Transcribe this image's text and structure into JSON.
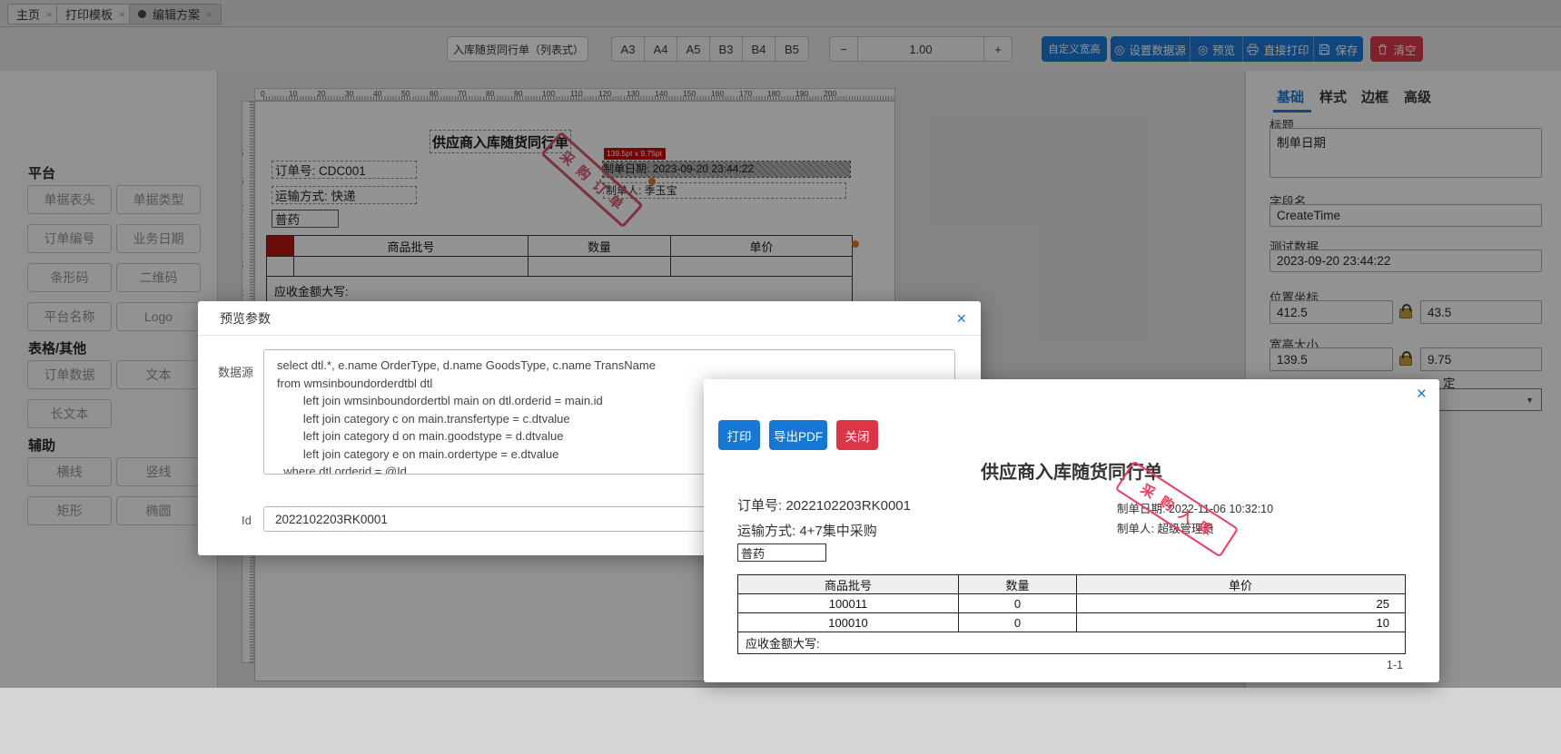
{
  "tabs": {
    "items": [
      {
        "label": "主页"
      },
      {
        "label": "打印模板"
      },
      {
        "label": "编辑方案"
      }
    ],
    "close_glyph": "×"
  },
  "toolbar": {
    "template_name": "入库随货同行单（列表式）【带",
    "paper_sizes": [
      "A3",
      "A4",
      "A5",
      "B3",
      "B4",
      "B5"
    ],
    "zoom_out": "−",
    "zoom_value": "1.00",
    "zoom_in": "+",
    "custom_size": "自定义宽高",
    "set_datasource": "设置数据源",
    "preview": "预览",
    "direct_print": "直接打印",
    "save": "保存",
    "clear": "清空",
    "ring_icon": "◎"
  },
  "sidebar": {
    "sections": [
      {
        "title": "平台",
        "buttons": [
          "单据表头",
          "单据类型",
          "订单编号",
          "业务日期",
          "条形码",
          "二维码",
          "平台名称",
          "Logo"
        ]
      },
      {
        "title": "表格/其他",
        "buttons": [
          "订单数据",
          "文本",
          "长文本"
        ]
      },
      {
        "title": "辅助",
        "buttons": [
          "横线",
          "竖线",
          "矩形",
          "椭圆"
        ]
      }
    ]
  },
  "canvas": {
    "ruler_h": [
      "0",
      "10",
      "20",
      "30",
      "40",
      "50",
      "60",
      "70",
      "80",
      "90",
      "100",
      "110",
      "120",
      "130",
      "140",
      "150",
      "160",
      "170",
      "180",
      "190",
      "200"
    ],
    "ruler_v": [
      "10",
      "20",
      "30",
      "40",
      "50",
      "60"
    ],
    "doc": {
      "title": "供应商入库随货同行单",
      "order_no": "订单号: CDC001",
      "transport": "运输方式: 快递",
      "drug_type": "普药",
      "size_tooltip": "139.5pt x 9.75pt",
      "create_date": "制单日期: 2023-09-20 23:44:22",
      "creator": "制单人: 季玉宝",
      "stamp": "采购订单",
      "table": {
        "headers": [
          "商品批号",
          "数量",
          "单价"
        ],
        "footer": "应收金额大写:"
      }
    }
  },
  "panel": {
    "tabs": [
      "基础",
      "样式",
      "边框",
      "高级"
    ],
    "title_label": "标题",
    "title_value": "制单日期",
    "field_label": "字段名",
    "field_value": "CreateTime",
    "test_label": "测试数据",
    "test_value": "2023-09-20 23:44:22",
    "pos_label": "位置坐标",
    "pos_x": "412.5",
    "pos_y": "43.5",
    "size_label": "宽高大小",
    "size_w": "139.5",
    "size_h": "9.75",
    "partial_label": "定",
    "select_chevron": "▼"
  },
  "params_modal": {
    "title": "预览参数",
    "close_glyph": "×",
    "datasource_label": "数据源",
    "sql": "select dtl.*, e.name OrderType, d.name GoodsType, c.name TransName\nfrom wmsinboundorderdtbl dtl\n        left join wmsinboundordertbl main on dtl.orderid = main.id\n        left join category c on main.transfertype = c.dtvalue\n        left join category d on main.goodstype = d.dtvalue\n        left join category e on main.ordertype = e.dtvalue\n  where dtl.orderid = @Id",
    "id_label": "Id",
    "id_value": "2022102203RK0001"
  },
  "preview_modal": {
    "close_glyph": "×",
    "print_btn": "打印",
    "export_pdf_btn": "导出PDF",
    "close_btn": "关闭",
    "doc": {
      "title": "供应商入库随货同行单",
      "order_no": "订单号: 2022102203RK0001",
      "transport": "运输方式: 4+7集中采购",
      "drug_type": "普药",
      "create_date": "制单日期: 2022-11-06 10:32:10",
      "creator": "制单人: 超级管理员",
      "stamp": "采购入库",
      "table": {
        "headers": [
          "商品批号",
          "数量",
          "单价"
        ],
        "rows": [
          [
            "100011",
            "0",
            "25"
          ],
          [
            "100010",
            "0",
            "10"
          ]
        ],
        "footer": "应收金额大写:"
      },
      "page": "1-1"
    }
  },
  "colors": {
    "accent_blue": "#1677d4",
    "danger_red": "#dc3545",
    "stamp_red": "#d8536b",
    "tooltip_red": "#c40000",
    "marker_red": "#b30f0f",
    "handle_orange": "#e07820"
  }
}
